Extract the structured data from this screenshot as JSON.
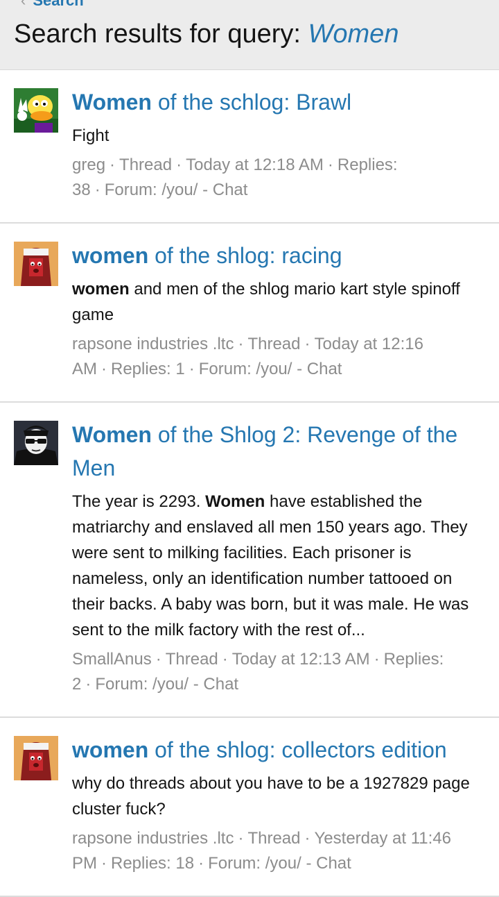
{
  "header": {
    "back_label": "Search",
    "title_prefix": "Search results for query:",
    "query": "Women"
  },
  "results": [
    {
      "title_highlight": "Women",
      "title_rest": " of the schlog: Brawl",
      "snippet_pre": "Fight",
      "snippet_highlight": "",
      "snippet_post": "",
      "author": "greg",
      "type": "Thread",
      "time": "Today at 12:18 AM",
      "replies": "Replies: 38",
      "forum": "Forum: /you/ - Chat",
      "avatar": "duck-avatar"
    },
    {
      "title_highlight": "women",
      "title_rest": " of the shlog: racing",
      "snippet_pre": "",
      "snippet_highlight": "women",
      "snippet_post": " and men of the shlog mario kart style spinoff game",
      "author": "rapsone industries .ltc",
      "type": "Thread",
      "time": "Today at 12:16 AM",
      "replies": "Replies: 1",
      "forum": "Forum: /you/ - Chat",
      "avatar": "hooded-avatar"
    },
    {
      "title_highlight": "Women",
      "title_rest": " of the Shlog 2: Revenge of the Men",
      "snippet_pre": "The year is 2293. ",
      "snippet_highlight": "Women",
      "snippet_post": " have established the matriarchy and enslaved all men 150 years ago. They were sent to milking facilities. Each prisoner is nameless, only an identification number tattooed on their backs. A baby was born, but it was male. He was sent to the milk factory with the rest of...",
      "author": "SmallAnus",
      "type": "Thread",
      "time": "Today at 12:13 AM",
      "replies": "Replies: 2",
      "forum": "Forum: /you/ - Chat",
      "avatar": "sunglasses-avatar"
    },
    {
      "title_highlight": "women",
      "title_rest": " of the shlog: collectors edition",
      "snippet_pre": "why do threads about you have to be a 1927829 page cluster fuck?",
      "snippet_highlight": "",
      "snippet_post": "",
      "author": "rapsone industries .ltc",
      "type": "Thread",
      "time": "Yesterday at 11:46 PM",
      "replies": "Replies: 18",
      "forum": "Forum: /you/ - Chat",
      "avatar": "hooded-avatar"
    }
  ],
  "separator": "·",
  "colors": {
    "link": "#2577b1",
    "meta": "#8c8c8c",
    "text": "#141414",
    "header_bg": "#ececec"
  }
}
